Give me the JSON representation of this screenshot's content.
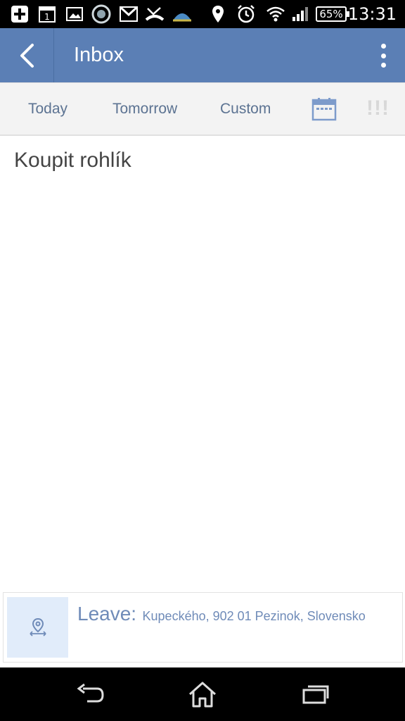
{
  "status_bar": {
    "time": "13:31",
    "battery_percent": "65%",
    "calendar_icon_day": "1",
    "icons": [
      "add-box-icon",
      "calendar-icon",
      "image-icon",
      "camera-app-icon",
      "gmail-icon",
      "missed-call-icon",
      "weather-icon",
      "location-icon",
      "alarm-icon",
      "wifi-icon",
      "signal-icon",
      "battery-icon"
    ]
  },
  "app_bar": {
    "title": "Inbox",
    "back_icon": "back-arrow-icon",
    "menu_icon": "overflow-menu-icon"
  },
  "date_bar": {
    "today": "Today",
    "tomorrow": "Tomorrow",
    "custom": "Custom",
    "priority": "!!!"
  },
  "task": {
    "title": "Koupit rohlík"
  },
  "location_reminder": {
    "label": "Leave:",
    "address": "Kupeckého, 902 01 Pezinok, Slovensko"
  },
  "colors": {
    "app_bar": "#5b7fb5",
    "toolbar_bg": "#f3f3f3",
    "accent_text": "#5c7392",
    "location_icon_bg": "#e1ecfa"
  }
}
